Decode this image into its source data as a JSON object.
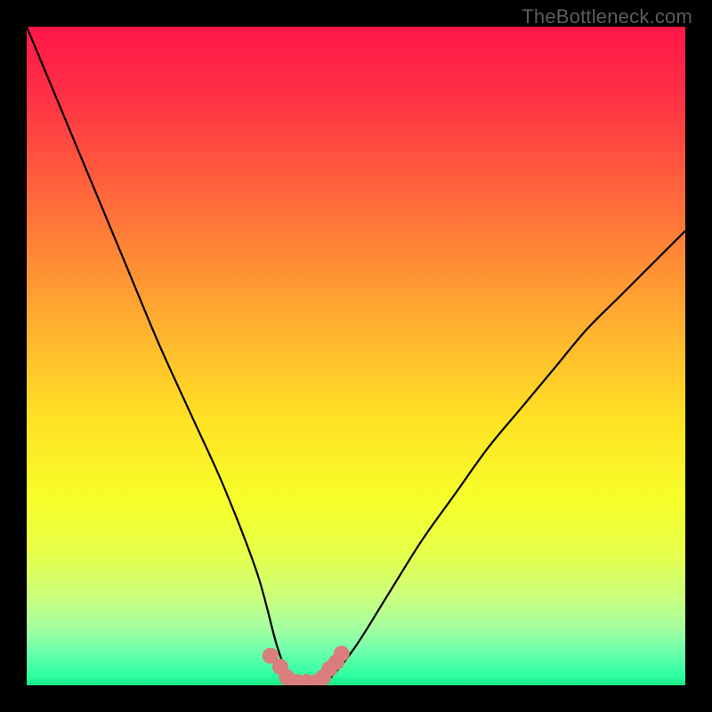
{
  "watermark": "TheBottleneck.com",
  "chart_data": {
    "type": "line",
    "title": "",
    "xlabel": "",
    "ylabel": "",
    "xlim": [
      0,
      100
    ],
    "ylim": [
      0,
      100
    ],
    "grid": false,
    "legend": false,
    "series": [
      {
        "name": "bottleneck-curve",
        "x": [
          0,
          5,
          10,
          15,
          20,
          25,
          30,
          35,
          38,
          40,
          42,
          44,
          46,
          50,
          55,
          60,
          65,
          70,
          75,
          80,
          85,
          90,
          95,
          100
        ],
        "y": [
          100,
          88,
          76,
          64,
          52,
          41,
          30,
          17,
          6,
          1,
          0,
          0,
          1,
          6,
          14,
          22,
          29,
          36,
          42,
          48,
          54,
          59,
          64,
          69
        ]
      },
      {
        "name": "highlight-dots",
        "x": [
          37,
          38.5,
          39.5,
          41,
          42.5,
          44,
          45,
          46,
          47,
          47.8
        ],
        "y": [
          4.5,
          2.8,
          1.2,
          0.5,
          0.5,
          0.5,
          1.2,
          2.5,
          3.5,
          4.8
        ]
      }
    ],
    "background_gradient": {
      "stops": [
        {
          "offset": 0.0,
          "color": "#ff1748"
        },
        {
          "offset": 0.1,
          "color": "#ff2f45"
        },
        {
          "offset": 0.22,
          "color": "#ff5a3e"
        },
        {
          "offset": 0.35,
          "color": "#ff8a36"
        },
        {
          "offset": 0.48,
          "color": "#ffb92d"
        },
        {
          "offset": 0.6,
          "color": "#ffe324"
        },
        {
          "offset": 0.72,
          "color": "#f6ff2a"
        },
        {
          "offset": 0.8,
          "color": "#e6ff4a"
        },
        {
          "offset": 0.86,
          "color": "#ceff79"
        },
        {
          "offset": 0.91,
          "color": "#a8ff9e"
        },
        {
          "offset": 0.95,
          "color": "#6cffad"
        },
        {
          "offset": 0.985,
          "color": "#2effa0"
        },
        {
          "offset": 1.0,
          "color": "#17e886"
        }
      ]
    },
    "highlight_color": "#d97d7d",
    "curve_color": "#000000"
  }
}
